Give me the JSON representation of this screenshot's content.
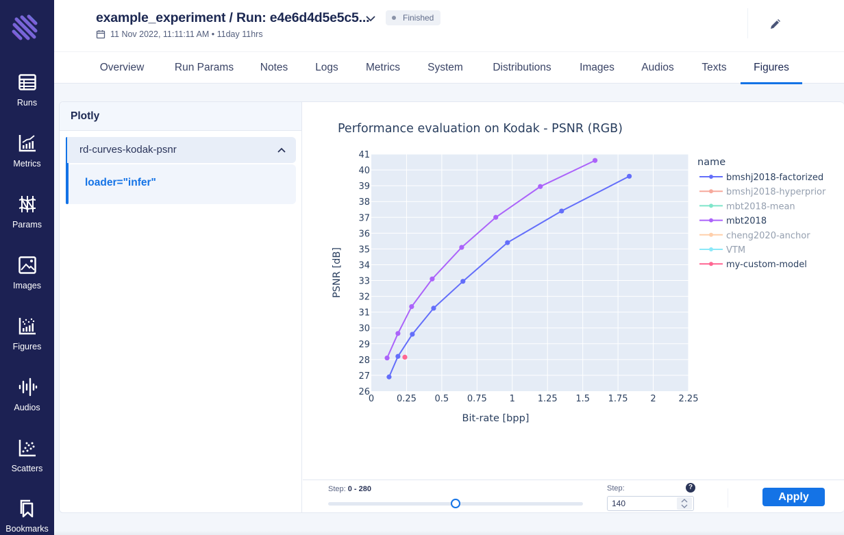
{
  "sidebar": {
    "items": [
      {
        "label": "Runs",
        "icon": "table-icon"
      },
      {
        "label": "Metrics",
        "icon": "line-chart-icon"
      },
      {
        "label": "Params",
        "icon": "params-icon"
      },
      {
        "label": "Images",
        "icon": "image-icon"
      },
      {
        "label": "Figures",
        "icon": "figures-icon"
      },
      {
        "label": "Audios",
        "icon": "audio-wave-icon"
      },
      {
        "label": "Scatters",
        "icon": "scatter-icon"
      },
      {
        "label": "Bookmarks",
        "icon": "bookmark-icon"
      }
    ]
  },
  "header": {
    "title": "example_experiment / Run: e4e6d4d5e5c5...",
    "status": "Finished",
    "date": "11 Nov 2022, 11:11:11 AM • 11day 11hrs"
  },
  "tabs": [
    {
      "label": "Overview",
      "active": false
    },
    {
      "label": "Run Params",
      "active": false
    },
    {
      "label": "Notes",
      "active": false
    },
    {
      "label": "Logs",
      "active": false
    },
    {
      "label": "Metrics",
      "active": false
    },
    {
      "label": "System",
      "active": false
    },
    {
      "label": "Distributions",
      "active": false
    },
    {
      "label": "Images",
      "active": false
    },
    {
      "label": "Audios",
      "active": false
    },
    {
      "label": "Texts",
      "active": false
    },
    {
      "label": "Figures",
      "active": true
    }
  ],
  "left_panel": {
    "title": "Plotly",
    "group": {
      "name": "rd-curves-kodak-psnr",
      "item": "loader=\"infer\""
    }
  },
  "controls": {
    "step_label": "Step:",
    "step_range": "0 - 280",
    "step_min": 0,
    "step_max": 280,
    "slider_value": 140,
    "step_input_label": "Step:",
    "step_input_value": "140",
    "help": "?",
    "apply_label": "Apply"
  },
  "colors": {
    "accent": "#1473e6",
    "sidebar_bg": "#1c2153"
  },
  "chart_data": {
    "type": "line",
    "title": "Performance evaluation on Kodak - PSNR (RGB)",
    "xlabel": "Bit-rate [bpp]",
    "ylabel": "PSNR [dB]",
    "xlim": [
      0,
      2.25
    ],
    "ylim": [
      26,
      41
    ],
    "xticks": [
      "0",
      "0.25",
      "0.5",
      "0.75",
      "1",
      "1.25",
      "1.5",
      "1.75",
      "2",
      "2.25"
    ],
    "yticks": [
      "26",
      "27",
      "28",
      "29",
      "30",
      "31",
      "32",
      "33",
      "34",
      "35",
      "36",
      "37",
      "38",
      "39",
      "40",
      "41"
    ],
    "grid": true,
    "legend_title": "name",
    "legend_position": "right",
    "series": [
      {
        "name": "bmshj2018-factorized",
        "color": "#636efa",
        "visible": true,
        "x": [
          0.126,
          0.189,
          0.291,
          0.442,
          0.65,
          0.966,
          1.35,
          1.83
        ],
        "y": [
          26.9,
          28.2,
          29.6,
          31.25,
          32.95,
          35.4,
          37.4,
          39.6
        ]
      },
      {
        "name": "bmshj2018-hyperprior",
        "color": "#ef553b",
        "visible": false,
        "x": [],
        "y": []
      },
      {
        "name": "mbt2018-mean",
        "color": "#00cc96",
        "visible": false,
        "x": [],
        "y": []
      },
      {
        "name": "mbt2018",
        "color": "#ab63fa",
        "visible": true,
        "x": [
          0.112,
          0.189,
          0.286,
          0.432,
          0.641,
          0.883,
          1.199,
          1.587
        ],
        "y": [
          28.1,
          29.65,
          31.35,
          33.1,
          35.1,
          37.0,
          38.95,
          40.6
        ]
      },
      {
        "name": "cheng2020-anchor",
        "color": "#ffa15a",
        "visible": false,
        "x": [],
        "y": []
      },
      {
        "name": "VTM",
        "color": "#19d3f3",
        "visible": false,
        "x": [],
        "y": []
      },
      {
        "name": "my-custom-model",
        "color": "#ff6692",
        "visible": true,
        "x": [
          0.238
        ],
        "y": [
          28.15
        ]
      }
    ]
  }
}
